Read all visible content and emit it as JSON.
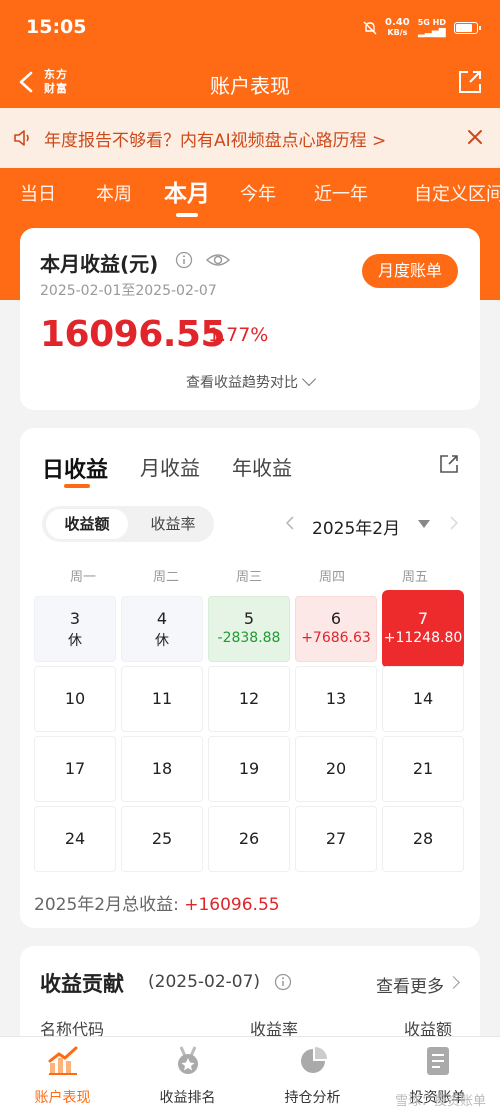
{
  "status_bar": {
    "time": "15:05",
    "net_speed": "0.40",
    "net_unit": "KB/s",
    "net_type": "5G HD"
  },
  "header": {
    "logo_line1": "东方",
    "logo_line2": "财富",
    "title": "账户表现"
  },
  "notice": {
    "text": "年度报告不够看？内有AI视频盘点心路历程 >"
  },
  "period_tabs": [
    {
      "label": "当日",
      "active": false
    },
    {
      "label": "本周",
      "active": false
    },
    {
      "label": "本月",
      "active": true
    },
    {
      "label": "今年",
      "active": false
    },
    {
      "label": "近一年",
      "active": false
    },
    {
      "label": "自定义区间",
      "active": false
    }
  ],
  "summary": {
    "title": "本月收益(元)",
    "date_range": "2025-02-01至2025-02-07",
    "bill_button": "月度账单",
    "amount": "16096.55",
    "rate": "1.77%",
    "trend_link": "查看收益趋势对比"
  },
  "profit_panel": {
    "tabs": [
      {
        "label": "日收益",
        "active": true
      },
      {
        "label": "月收益",
        "active": false
      },
      {
        "label": "年收益",
        "active": false
      }
    ],
    "segment": {
      "amount": "收益额",
      "rate": "收益率"
    },
    "month": "2025年2月",
    "weekdays": [
      "周一",
      "周二",
      "周三",
      "周四",
      "周五"
    ],
    "calendar": [
      [
        {
          "day": "3",
          "value": "休",
          "state": "rest"
        },
        {
          "day": "4",
          "value": "休",
          "state": "rest"
        },
        {
          "day": "5",
          "value": "-2838.88",
          "state": "down"
        },
        {
          "day": "6",
          "value": "+7686.63",
          "state": "up"
        },
        {
          "day": "7",
          "value": "+11248.80",
          "state": "bigup"
        }
      ],
      [
        {
          "day": "10",
          "value": "",
          "state": "none"
        },
        {
          "day": "11",
          "value": "",
          "state": "none"
        },
        {
          "day": "12",
          "value": "",
          "state": "none"
        },
        {
          "day": "13",
          "value": "",
          "state": "none"
        },
        {
          "day": "14",
          "value": "",
          "state": "none"
        }
      ],
      [
        {
          "day": "17",
          "value": "",
          "state": "none"
        },
        {
          "day": "18",
          "value": "",
          "state": "none"
        },
        {
          "day": "19",
          "value": "",
          "state": "none"
        },
        {
          "day": "20",
          "value": "",
          "state": "none"
        },
        {
          "day": "21",
          "value": "",
          "state": "none"
        }
      ],
      [
        {
          "day": "24",
          "value": "",
          "state": "none"
        },
        {
          "day": "25",
          "value": "",
          "state": "none"
        },
        {
          "day": "26",
          "value": "",
          "state": "none"
        },
        {
          "day": "27",
          "value": "",
          "state": "none"
        },
        {
          "day": "28",
          "value": "",
          "state": "none"
        }
      ]
    ],
    "total_label": "2025年2月总收益:",
    "total_value": "+16096.55"
  },
  "contribution": {
    "title": "收益贡献",
    "date": "(2025-02-07)",
    "more": "查看更多",
    "columns": [
      "名称代码",
      "收益率",
      "收益额"
    ]
  },
  "bottom_nav": [
    {
      "label": "账户表现",
      "icon": "chart-icon",
      "active": true
    },
    {
      "label": "收益排名",
      "icon": "medal-icon",
      "active": false
    },
    {
      "label": "持仓分析",
      "icon": "pie-icon",
      "active": false
    },
    {
      "label": "投资账单",
      "icon": "document-icon",
      "active": false
    }
  ],
  "watermark": "雪球：投资账单",
  "colors": {
    "brand": "#ff6a14",
    "gain": "#e0262a",
    "loss": "#1e9a32"
  }
}
